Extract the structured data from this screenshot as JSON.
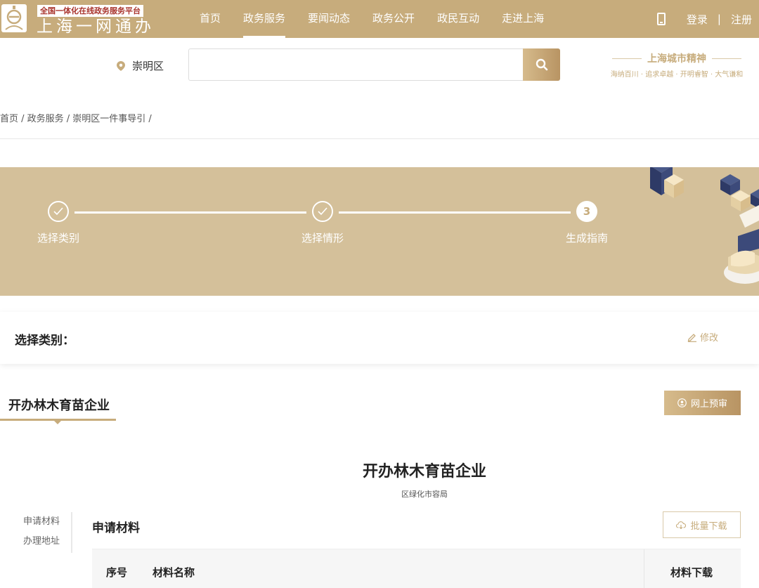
{
  "header": {
    "logo_tag": "全国一体化在线政务服务平台",
    "logo_name": "上海一网通办",
    "nav": [
      "首页",
      "政务服务",
      "要闻动态",
      "政务公开",
      "政民互动",
      "走进上海"
    ],
    "active_nav_index": 1,
    "login": "登录",
    "divider": "|",
    "register": "注册",
    "colors": {
      "brand": "#c7ac7c",
      "logo_tag_text": "#a8322b"
    }
  },
  "search": {
    "location": "崇明区",
    "placeholder": "",
    "spirit_title": "上海城市精神",
    "spirit_sub": "海纳百川 · 追求卓越 · 开明睿智 · 大气谦和"
  },
  "breadcrumb": "首页 / 政务服务 / 崇明区一件事导引 /",
  "steps": [
    {
      "label": "选择类别",
      "state": "done"
    },
    {
      "label": "选择情形",
      "state": "done"
    },
    {
      "label": "生成指南",
      "state": "current",
      "number": "3"
    }
  ],
  "category": {
    "label": "选择类别：",
    "edit": "修改"
  },
  "item": {
    "tab": "开办林木育苗企业",
    "apply_button": "网上预审",
    "title": "开办林木育苗企业",
    "department": "区绿化市容局"
  },
  "side_nav": [
    "申请材料",
    "办理地址"
  ],
  "materials": {
    "title": "申请材料",
    "batch_download": "批量下载",
    "columns": [
      "序号",
      "材料名称",
      "材料下载"
    ]
  }
}
